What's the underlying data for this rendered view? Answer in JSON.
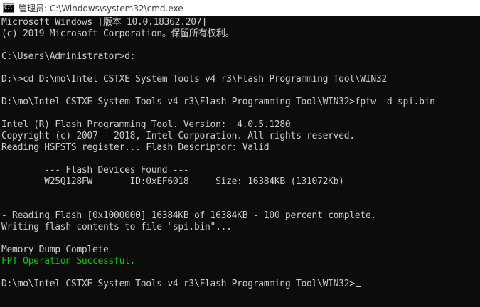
{
  "window": {
    "title": "管理员: C:\\Windows\\system32\\cmd.exe",
    "icon": "cmd-icon",
    "icon_text": "C:\\",
    "colors": {
      "background": "#0c0c0c",
      "text": "#cccccc",
      "success": "#16c60c"
    }
  },
  "console": {
    "lines": [
      "Microsoft Windows [版本 10.0.18362.207]",
      "(c) 2019 Microsoft Corporation。保留所有权利。",
      "",
      "C:\\Users\\Administrator>d:",
      "",
      "D:\\>cd D:\\mo\\Intel CSTXE System Tools v4 r3\\Flash Programming Tool\\WIN32",
      "",
      "D:\\mo\\Intel CSTXE System Tools v4 r3\\Flash Programming Tool\\WIN32>fptw -d spi.bin",
      "",
      "Intel (R) Flash Programming Tool. Version:  4.0.5.1280",
      "Copyright (c) 2007 - 2018, Intel Corporation. All rights reserved.",
      "Reading HSFSTS register... Flash Descriptor: Valid",
      "",
      "        --- Flash Devices Found ---",
      "        W25Q128FW       ID:0xEF6018     Size: 16384KB (131072Kb)",
      "",
      "",
      "- Reading Flash [0x1000000] 16384KB of 16384KB - 100 percent complete.",
      "Writing flash contents to file \"spi.bin\"...",
      "",
      "Memory Dump Complete",
      "FPT Operation Successful.",
      "",
      "D:\\mo\\Intel CSTXE System Tools v4 r3\\Flash Programming Tool\\WIN32>"
    ]
  }
}
